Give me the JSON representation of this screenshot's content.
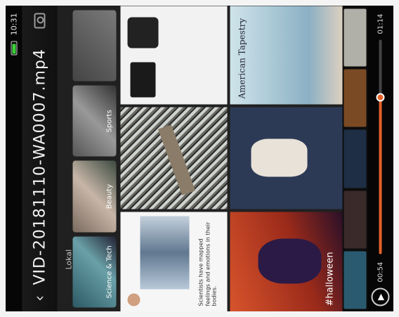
{
  "status": {
    "time": "10:31"
  },
  "player": {
    "title": "VID-20181110-WA0007.mp4",
    "time_current": "00:54",
    "time_total": "01:14",
    "progress_fraction": 0.73,
    "accent_color": "#e5622a"
  },
  "video_content": {
    "section_label": "Lokal",
    "categories": [
      {
        "label": "Science & Tech"
      },
      {
        "label": "Beauty"
      },
      {
        "label": "Sports"
      },
      {
        "label": ""
      }
    ],
    "post_text": "Scientists have mapped feelings and emotions in their bodies.",
    "halloween_tag": "#halloween",
    "magazine_headline": "American Tapestry"
  },
  "icons": {
    "back": "back-arrow-icon",
    "screenshot": "camera-icon",
    "play": "play-icon"
  }
}
